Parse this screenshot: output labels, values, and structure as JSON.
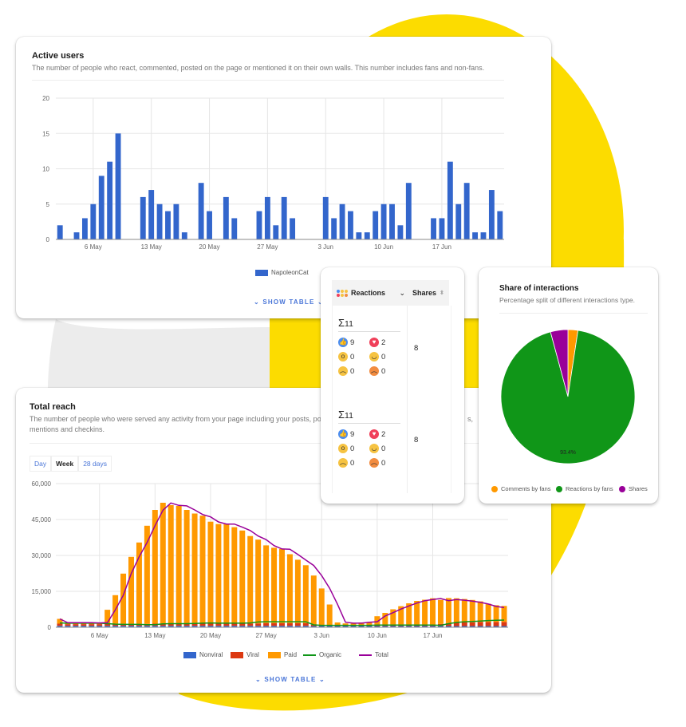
{
  "active_users": {
    "title": "Active users",
    "description": "The number of people who react, commented, posted on the page or mentioned it on their own walls. This number includes fans and non-fans.",
    "show_table": "SHOW TABLE",
    "chart_data": {
      "type": "bar",
      "title": "Active users",
      "xlabel": "",
      "ylabel": "",
      "ylim": [
        0,
        20
      ],
      "yticks": [
        "0",
        "5",
        "10",
        "15",
        "20"
      ],
      "xticks": [
        "6 May",
        "13 May",
        "20 May",
        "27 May",
        "3 Jun",
        "10 Jun",
        "17 Jun"
      ],
      "legend": "bottom",
      "series": [
        {
          "name": "NapoleonCat",
          "color": "#3366cc",
          "values": [
            2,
            0,
            1,
            3,
            5,
            9,
            11,
            15,
            0,
            0,
            6,
            7,
            5,
            4,
            5,
            1,
            0,
            8,
            4,
            0,
            6,
            3,
            0,
            0,
            4,
            6,
            2,
            6,
            3,
            0,
            0,
            0,
            6,
            3,
            5,
            4,
            1,
            1,
            4,
            5,
            5,
            2,
            8,
            0,
            0,
            3,
            3,
            11,
            5,
            8,
            1,
            1,
            7,
            4
          ]
        }
      ]
    }
  },
  "reactions_table": {
    "col_reactions": "Reactions",
    "col_shares": "Shares",
    "rows": [
      {
        "sum": "11",
        "like": "9",
        "love": "2",
        "wow": "0",
        "haha": "0",
        "sad": "0",
        "angry": "0",
        "shares": "8"
      },
      {
        "sum": "11",
        "like": "9",
        "love": "2",
        "wow": "0",
        "haha": "0",
        "sad": "0",
        "angry": "0",
        "shares": "8"
      }
    ],
    "sum_symbol": "Σ"
  },
  "share_of_interactions": {
    "title": "Share of interactions",
    "description": "Percentage split of different interactions type.",
    "chart_data": {
      "type": "pie",
      "title": "Share of interactions",
      "legend": "bottom",
      "slices": [
        {
          "name": "Comments by fans",
          "value": 2.4,
          "color": "#ff9900"
        },
        {
          "name": "Reactions by fans",
          "value": 93.4,
          "color": "#109618",
          "label": "93.4%"
        },
        {
          "name": "Shares",
          "value": 4.2,
          "color": "#990099"
        }
      ]
    }
  },
  "total_reach": {
    "title": "Total reach",
    "description_line1": "The number of people who were served any activity from your page including your posts, po",
    "description_tail": "s,",
    "description_line2": "mentions and checkins.",
    "tabs": [
      {
        "label": "Day",
        "active": false
      },
      {
        "label": "Week",
        "active": true
      },
      {
        "label": "28 days",
        "active": false
      }
    ],
    "show_table": "SHOW TABLE",
    "chart_data": {
      "type": "bar",
      "stacked": true,
      "title": "Total reach",
      "ylim": [
        0,
        60000
      ],
      "yticks": [
        "0",
        "15,000",
        "30,000",
        "45,000",
        "60,000"
      ],
      "xticks": [
        "6 May",
        "13 May",
        "20 May",
        "27 May",
        "3 Jun",
        "10 Jun",
        "17 Jun"
      ],
      "legend": "bottom",
      "series": [
        {
          "name": "Nonviral",
          "kind": "bar",
          "color": "#3366cc",
          "values": [
            600,
            600,
            600,
            600,
            600,
            600,
            600,
            600,
            600,
            600,
            600,
            600,
            600,
            600,
            600,
            600,
            600,
            600,
            600,
            600,
            600,
            600,
            600,
            600,
            600,
            600,
            600,
            600,
            600,
            600,
            600,
            600,
            500,
            500,
            500,
            500,
            500,
            500,
            500,
            500,
            500,
            500,
            500,
            500,
            500,
            500,
            500,
            500,
            500,
            500,
            500,
            500,
            500,
            500,
            500,
            500,
            500
          ]
        },
        {
          "name": "Viral",
          "kind": "bar",
          "color": "#dc3912",
          "values": [
            900,
            700,
            700,
            700,
            700,
            700,
            800,
            800,
            800,
            800,
            800,
            800,
            900,
            900,
            900,
            900,
            900,
            900,
            1000,
            1000,
            1000,
            1000,
            1000,
            1000,
            1000,
            1000,
            1100,
            1100,
            1100,
            1100,
            1100,
            1100,
            600,
            500,
            500,
            500,
            500,
            500,
            500,
            500,
            500,
            500,
            500,
            500,
            500,
            500,
            500,
            600,
            900,
            1200,
            1400,
            1500,
            1600,
            1700,
            1700,
            1700,
            1700
          ]
        },
        {
          "name": "Paid",
          "kind": "bar",
          "color": "#ff9900",
          "values": [
            2000,
            600,
            600,
            600,
            600,
            600,
            5900,
            12000,
            21000,
            28000,
            34000,
            41000,
            47500,
            50500,
            49500,
            49200,
            47500,
            46000,
            45000,
            42500,
            41500,
            41500,
            40200,
            38800,
            36500,
            35000,
            32500,
            31500,
            31000,
            28800,
            26500,
            24200,
            20500,
            15200,
            8500,
            1000,
            600,
            600,
            1000,
            1200,
            3600,
            5000,
            6500,
            7800,
            9000,
            10000,
            10500,
            11000,
            10000,
            10500,
            10200,
            9800,
            9300,
            8600,
            7600,
            7000,
            6700
          ]
        },
        {
          "name": "Organic",
          "kind": "line",
          "color": "#109618",
          "values": [
            1800,
            1700,
            1700,
            1700,
            1700,
            1700,
            1500,
            1300,
            1200,
            1200,
            1200,
            1100,
            1100,
            1400,
            1500,
            1500,
            1500,
            1600,
            1700,
            1800,
            1700,
            1700,
            1700,
            1700,
            1800,
            2200,
            2300,
            2300,
            2300,
            2300,
            2300,
            2300,
            1000,
            800,
            800,
            800,
            800,
            800,
            800,
            800,
            900,
            900,
            900,
            900,
            900,
            900,
            900,
            900,
            800,
            1500,
            2000,
            2300,
            2400,
            2600,
            2800,
            2900,
            3000
          ]
        },
        {
          "name": "Total",
          "kind": "line",
          "color": "#990099",
          "values": [
            3500,
            1900,
            1900,
            1900,
            1900,
            1800,
            1900,
            7300,
            13400,
            22400,
            29400,
            35400,
            42400,
            48900,
            51900,
            50900,
            50700,
            49000,
            47100,
            46100,
            44000,
            43100,
            43100,
            41800,
            40400,
            38100,
            36600,
            34100,
            32700,
            32600,
            30400,
            28100,
            25800,
            21600,
            16300,
            9600,
            2100,
            1700,
            1700,
            2100,
            2300,
            4700,
            6100,
            7600,
            8900,
            10100,
            11100,
            11600,
            12000,
            11100,
            11600,
            11300,
            10900,
            10400,
            9700,
            8700,
            8200
          ]
        }
      ]
    }
  },
  "colors": {
    "accent_yellow": "#fcdc00",
    "bg_gray": "#ececec",
    "link_blue": "#4a76d8"
  }
}
